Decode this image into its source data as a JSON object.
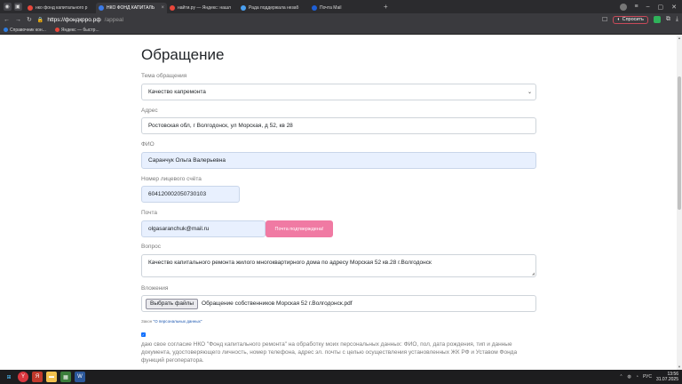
{
  "browser": {
    "tabs": [
      {
        "label": "нко фонд капитального р",
        "color": "#e8473b",
        "active": false
      },
      {
        "label": "НКО ФОНД КАПИТАЛЬ",
        "color": "#3b7be8",
        "active": true
      },
      {
        "label": "найти.ру — Яндекс: нашл",
        "color": "#e8473b",
        "active": false
      },
      {
        "label": "Рада поддержала незаб",
        "color": "#4aa0f0",
        "active": false
      },
      {
        "label": "Почта Mail",
        "color": "#1e5fd6",
        "active": false
      }
    ],
    "url_host": "https://фондкрро.рф",
    "url_path": "/appeal",
    "ask_label": "Спросить",
    "bookmarks": [
      {
        "label": "Справочник кон...",
        "color": "#2f7de1"
      },
      {
        "label": "Яндекс — быстр...",
        "color": "#e8473b"
      }
    ]
  },
  "form": {
    "title": "Обращение",
    "topic": {
      "label": "Тема обращения",
      "value": "Качество капремонта"
    },
    "address": {
      "label": "Адрес",
      "value": "Ростовская обл, г Волгодонск, ул Морская, д 52, кв 28"
    },
    "fio": {
      "label": "ФИО",
      "value": "Саранчук Ольга Валерьевна"
    },
    "account": {
      "label": "Номер лицевого счёта",
      "value": "604120002050730103"
    },
    "email": {
      "label": "Почта",
      "value": "olgasaranchuk@mail.ru",
      "confirm_button": "Почта подтверждена!"
    },
    "question": {
      "label": "Вопрос",
      "value": "Качество капитального ремонта жилого многоквартирного дома по адресу Морская 52 кв.28 г.Волгодонск"
    },
    "attachments": {
      "label": "Вложения",
      "button": "Выбрать файлы",
      "filename": "Обращение собственников Морская 52 г.Волгодонск.pdf"
    },
    "law_prefix": "Закон ",
    "law_link": "\"О персональных данных\"",
    "consent_text": "даю свое согласие НКО \"Фонд капитального ремонта\" на обработку моих персональных данных: ФИО, пол, дата рождения, тип и данные документа, удостоверяющего личность, номер телефона, адрес эл. почты с целью осуществления установленных ЖК РФ и Уставом Фонда функций регоператора."
  },
  "taskbar": {
    "lang": "РУС",
    "time": "13:56",
    "date": "31.07.2025"
  }
}
